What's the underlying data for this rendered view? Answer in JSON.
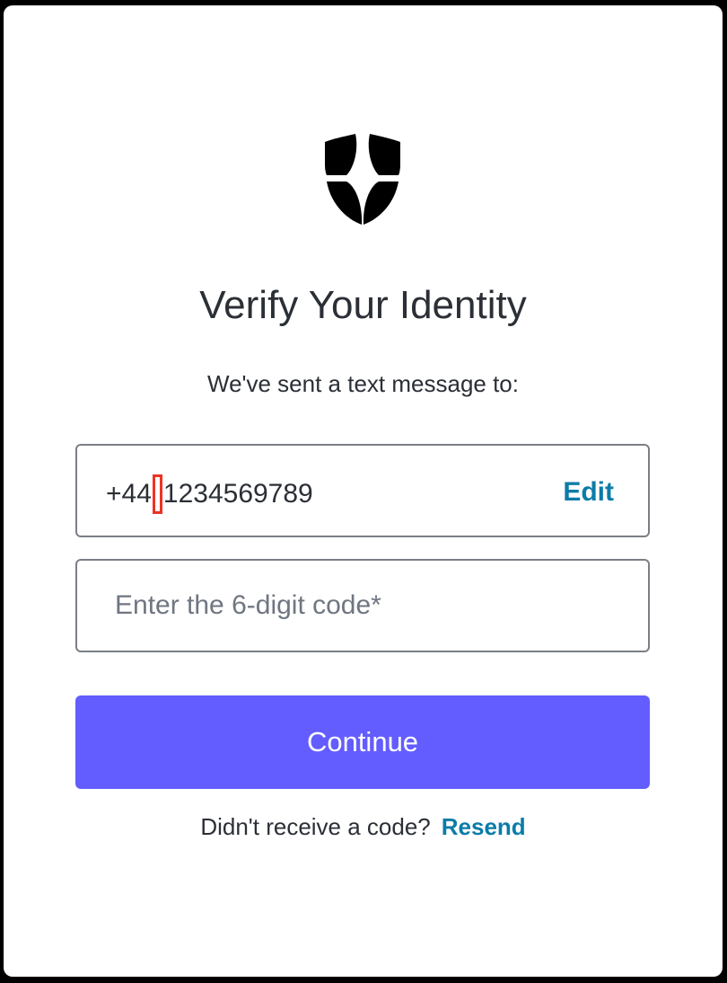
{
  "logo": {
    "icon": "shield-logo-icon",
    "color": "#000000"
  },
  "header": {
    "title": "Verify Your Identity",
    "subtitle": "We've sent a text message to:"
  },
  "phone": {
    "prefix": "+44",
    "number": "1234569789",
    "edit_label": "Edit"
  },
  "code": {
    "placeholder": "Enter the 6-digit code*",
    "value": ""
  },
  "actions": {
    "continue_label": "Continue"
  },
  "resend": {
    "prompt": "Didn't receive a code?",
    "link_label": "Resend"
  },
  "colors": {
    "primary": "#635dff",
    "link": "#0c7ca8",
    "text": "#2b2f36",
    "highlight": "#ee3322"
  }
}
